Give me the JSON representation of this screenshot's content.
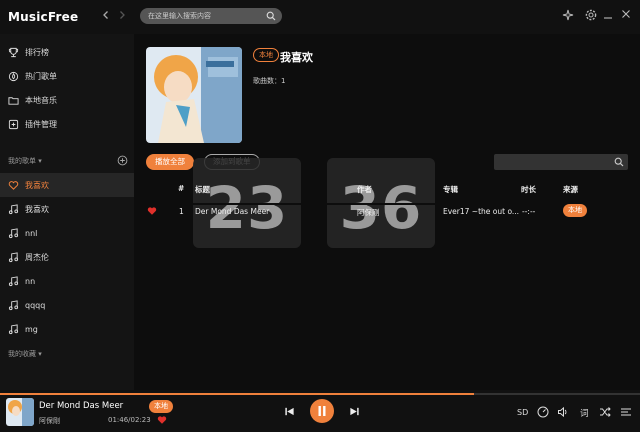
{
  "app": {
    "title": "MusicFree"
  },
  "search": {
    "placeholder": "在这里输入搜索内容"
  },
  "sidebar": {
    "items": [
      {
        "label": "排行榜",
        "icon": "trophy-icon"
      },
      {
        "label": "热门歌单",
        "icon": "fire-icon"
      },
      {
        "label": "本地音乐",
        "icon": "folder-icon"
      },
      {
        "label": "插件管理",
        "icon": "plugin-icon"
      }
    ],
    "my_playlists_title": "我的歌单",
    "playlists": [
      {
        "label": "我喜欢",
        "icon": "heart-icon"
      },
      {
        "label": "我喜欢",
        "icon": "music-note-icon"
      },
      {
        "label": "nnl",
        "icon": "music-note-icon"
      },
      {
        "label": "周杰伦",
        "icon": "music-note-icon"
      },
      {
        "label": "nn",
        "icon": "music-note-icon"
      },
      {
        "label": "qqqq",
        "icon": "music-note-icon"
      },
      {
        "label": "mg",
        "icon": "music-note-icon"
      }
    ],
    "favorites_title": "我的收藏"
  },
  "playlist": {
    "tag": "本地",
    "title": "我喜欢",
    "count_label": "歌曲数：",
    "count": "1",
    "play_all": "播放全部",
    "add_to": "添加到歌单"
  },
  "table": {
    "headers": {
      "index": "#",
      "title": "标题",
      "artist": "作者",
      "album": "专辑",
      "duration": "时长",
      "source": "来源"
    },
    "rows": [
      {
        "index": "1",
        "title": "Der Mond Das Meer",
        "artist": "阿保剛",
        "album": "Ever17 ~the out o...",
        "duration": "--:--",
        "source": "本地"
      }
    ]
  },
  "clock": {
    "hours": "23",
    "minutes": "36"
  },
  "player": {
    "title": "Der Mond Das Meer",
    "artist": "阿保剛",
    "tag": "本地",
    "time": "01:46/02:23",
    "progress": 0.74,
    "quality": "SD",
    "lyric": "词"
  },
  "colors": {
    "accent": "#f0813c",
    "heart": "#e0302b"
  }
}
